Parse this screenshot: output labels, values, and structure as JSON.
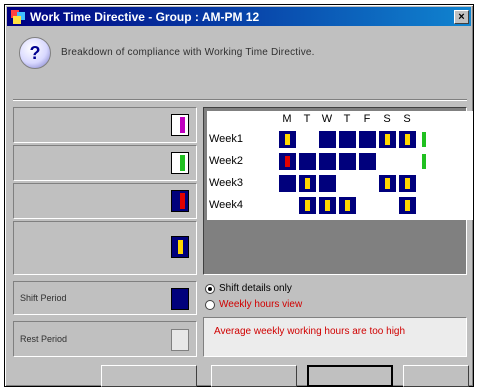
{
  "window": {
    "title": "Work Time Directive - Group : AM-PM 12"
  },
  "info": {
    "text": "Breakdown of compliance with Working Time Directive."
  },
  "legend": [
    {
      "label": "",
      "swatch": "purple-bar"
    },
    {
      "label": "",
      "swatch": "green-bar"
    },
    {
      "label": "",
      "swatch": "red-bar"
    },
    {
      "label": "",
      "swatch": "yellow-bar"
    },
    {
      "label": "Shift Period",
      "swatch": "shift"
    },
    {
      "label": "Rest Period",
      "swatch": "rest"
    }
  ],
  "grid": {
    "days": [
      "M",
      "T",
      "W",
      "T",
      "F",
      "S",
      "S"
    ],
    "weeks": [
      {
        "label": "Week1",
        "cells": [
          "yb",
          "rest",
          "shift",
          "shift",
          "shift",
          "yb",
          "yb",
          "green"
        ]
      },
      {
        "label": "Week2",
        "cells": [
          "rb",
          "shift",
          "shift",
          "shift",
          "shift",
          "rest",
          "rest",
          "green"
        ]
      },
      {
        "label": "Week3",
        "cells": [
          "shift",
          "yb",
          "shift",
          "rest",
          "rest",
          "yb",
          "yb",
          "rest"
        ]
      },
      {
        "label": "Week4",
        "cells": [
          "rest",
          "yb",
          "yb",
          "yb",
          "rest",
          "rest",
          "yb",
          "rest"
        ]
      }
    ]
  },
  "options": [
    {
      "label": "Shift details only",
      "checked": true,
      "color": "#000000"
    },
    {
      "label": "Weekly hours view",
      "checked": false,
      "color": "#d00000"
    }
  ],
  "warning": {
    "text": "Average weekly working hours are too high"
  },
  "buttons": [
    {
      "label": "",
      "enabled": false
    },
    {
      "label": "",
      "enabled": false
    },
    {
      "label": "",
      "enabled": true
    },
    {
      "label": "",
      "enabled": false
    }
  ],
  "colors": {
    "shift": "#00007c",
    "accent_yellow": "#ffd800",
    "accent_red": "#e00000",
    "accent_green": "#20c020",
    "warning": "#d00000"
  }
}
